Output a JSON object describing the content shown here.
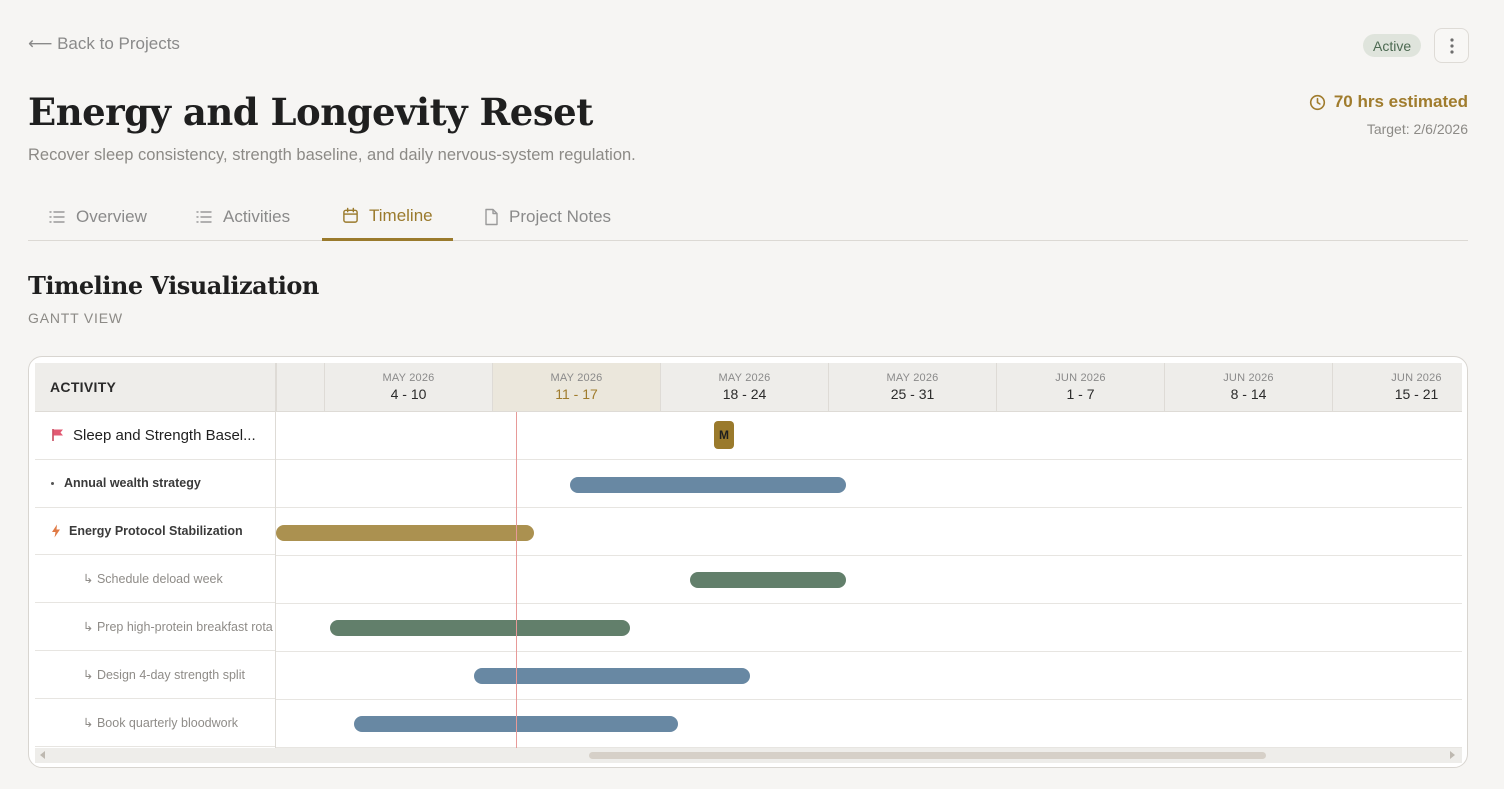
{
  "nav": {
    "back_label": "⟵ Back to Projects"
  },
  "status": {
    "label": "Active"
  },
  "project": {
    "title": "Energy and Longevity Reset",
    "subtitle": "Recover sleep consistency, strength baseline, and daily nervous-system regulation.",
    "estimate": "70 hrs estimated",
    "target": "Target: 2/6/2026"
  },
  "tabs": [
    {
      "label": "Overview",
      "icon": "list-icon"
    },
    {
      "label": "Activities",
      "icon": "list-icon"
    },
    {
      "label": "Timeline",
      "icon": "calendar-icon",
      "active": true
    },
    {
      "label": "Project Notes",
      "icon": "document-icon"
    }
  ],
  "section": {
    "title": "Timeline Visualization",
    "subtitle": "GANTT VIEW"
  },
  "gantt": {
    "activity_header": "ACTIVITY",
    "weeks": [
      {
        "month": "MAY 2026",
        "range": "4 - 10"
      },
      {
        "month": "MAY 2026",
        "range": "11 - 17",
        "current": true
      },
      {
        "month": "MAY 2026",
        "range": "18 - 24"
      },
      {
        "month": "MAY 2026",
        "range": "25 - 31"
      },
      {
        "month": "JUN 2026",
        "range": "1 - 7"
      },
      {
        "month": "JUN 2026",
        "range": "8 - 14"
      },
      {
        "month": "JUN 2026",
        "range": "15 - 21"
      }
    ],
    "rows": [
      {
        "label": "Sleep and Strength Basel...",
        "kind": "milestone",
        "icon": "flag-icon",
        "marker": "M"
      },
      {
        "label": "Annual wealth strategy",
        "kind": "group",
        "icon": "bullet-icon",
        "color": "#6888a3"
      },
      {
        "label": "Energy Protocol Stabilization",
        "kind": "group",
        "icon": "lightning-icon",
        "color": "#ab9150"
      },
      {
        "label": "↳ Schedule deload week",
        "kind": "sub",
        "color": "#627f6b"
      },
      {
        "label": "↳ Prep high-protein breakfast rota",
        "kind": "sub",
        "color": "#627f6b"
      },
      {
        "label": "↳ Design 4-day strength split",
        "kind": "sub",
        "color": "#6888a3"
      },
      {
        "label": "↳ Book quarterly bloodwork",
        "kind": "sub",
        "color": "#6888a3"
      }
    ]
  },
  "colors": {
    "accent": "#9a7a2c",
    "blue_bar": "#6888a3",
    "green_bar": "#627f6b",
    "gold_bar": "#ab9150",
    "today_line": "#e79a98",
    "active_badge_bg": "#dfe4dc"
  }
}
